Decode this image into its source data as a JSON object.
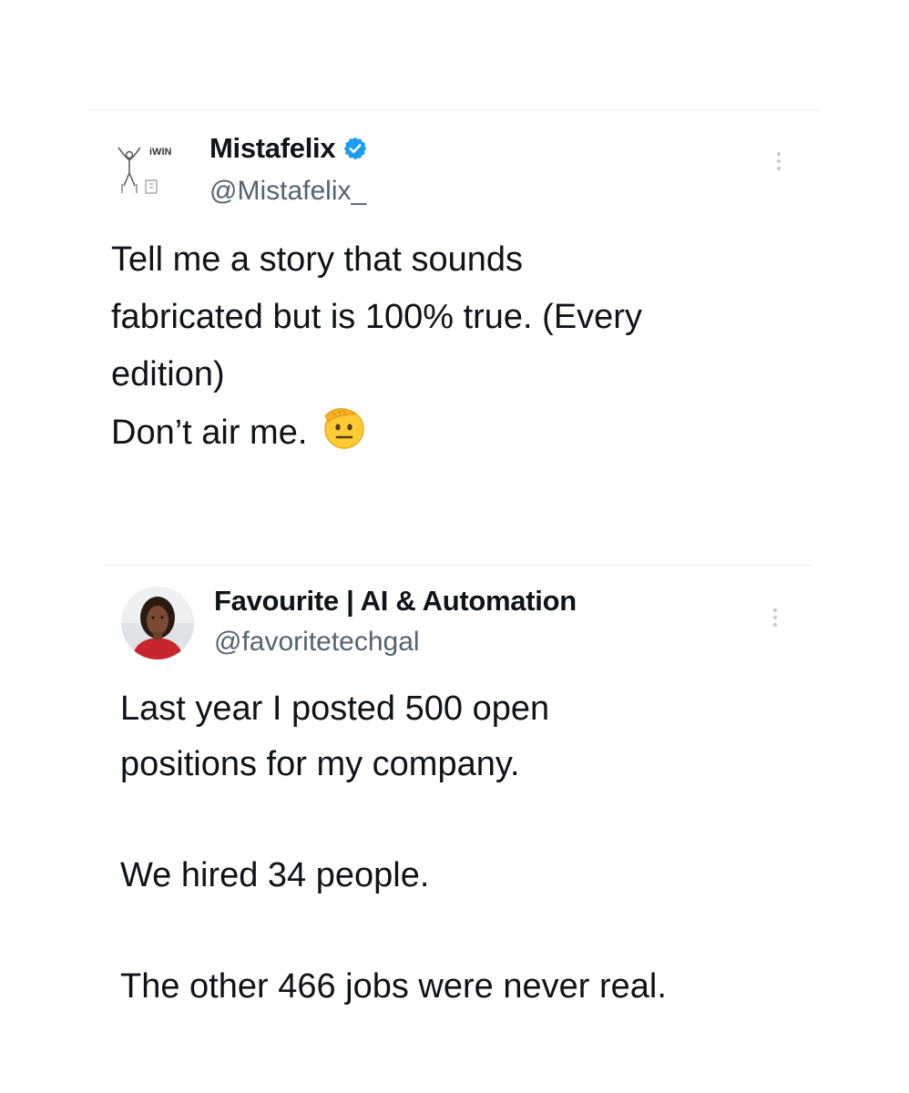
{
  "tweets": [
    {
      "display_name": "Mistafelix",
      "handle": "@Mistafelix_",
      "verified": true,
      "avatar_text": "iWIN",
      "more_icon": "three-dots-vertical",
      "text_lines": [
        "Tell me a story that sounds",
        "fabricated but is 100% true. (Every",
        "edition)",
        "Don’t air me."
      ],
      "emoji": "saluting-face"
    },
    {
      "display_name": "Favourite | AI & Automation",
      "handle": "@favoritetechgal",
      "verified": false,
      "more_icon": "three-dots-vertical",
      "text_lines": [
        "Last year I posted 500 open",
        "positions for my company.",
        "",
        "We hired 34 people.",
        "",
        "The other 466 jobs were never real."
      ]
    }
  ],
  "colors": {
    "verified_badge": "#1d9bf0",
    "handle": "#536471",
    "text": "#0f1419",
    "divider": "#ecedee"
  }
}
